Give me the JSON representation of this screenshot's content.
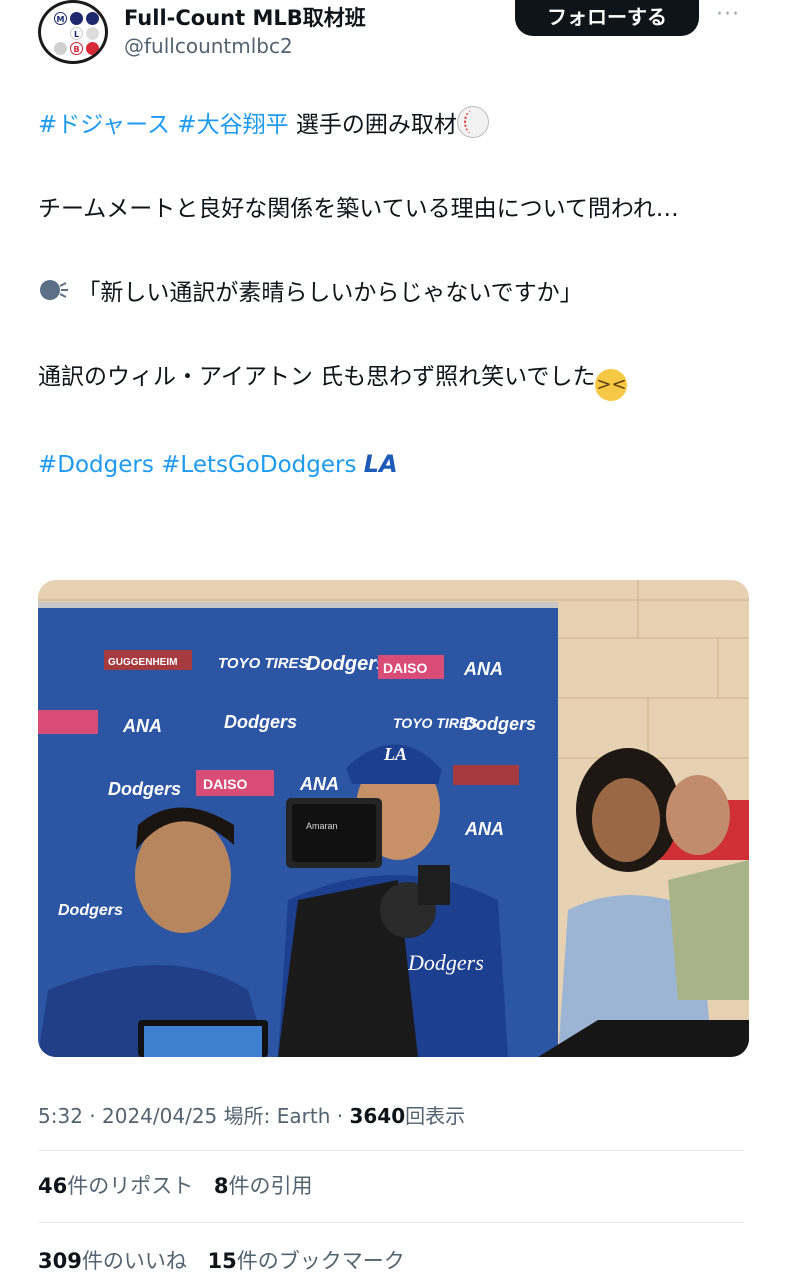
{
  "account": {
    "name": "Full-Count MLB取材班",
    "handle": "@fullcountmlbc2",
    "avatar_letters": [
      "M",
      "L",
      "B"
    ],
    "follow_label": "フォローする",
    "more_label": "···"
  },
  "tweet": {
    "line1": {
      "tag1": "#ドジャース",
      "tag2": "#大谷翔平",
      "text": "選手の囲み取材",
      "emoji": "baseball"
    },
    "line2": "チームメートと良好な関係を築いている理由について問われ…",
    "line3": {
      "emoji": "speaking-head",
      "text": "「新しい通訳が素晴らしいからじゃないですか」"
    },
    "line4": {
      "text": "通訳のウィル・アイアトン 氏も思わず照れ笑いでした",
      "emoji": "laughing-face"
    },
    "line5": {
      "tag1": "#Dodgers",
      "tag2": "#LetsGoDodgers",
      "logo": "LA"
    }
  },
  "photo": {
    "backdrop_logos": [
      "Dodgers",
      "GUGGENHEIM",
      "TOYO TIRES",
      "DAISO",
      "ANA"
    ],
    "camera_label": "Amaran",
    "cap_logo": "LA",
    "jersey_text": "Dodgers"
  },
  "meta": {
    "time": "5:32",
    "date": "2024/04/25",
    "location_label": "場所:",
    "location": "Earth",
    "views_count": "3640",
    "views_label": "回表示",
    "sep": "·"
  },
  "stats_row1": [
    {
      "count": "46",
      "label": "件のリポスト"
    },
    {
      "count": "8",
      "label": "件の引用"
    }
  ],
  "stats_row2": [
    {
      "count": "309",
      "label": "件のいいね"
    },
    {
      "count": "15",
      "label": "件のブックマーク"
    }
  ],
  "colors": {
    "accent": "#1d9bf0",
    "text": "#0f1419",
    "muted": "#536471",
    "backdrop_blue": "#2c55a4",
    "dodger_blue": "#1d3f8f"
  }
}
